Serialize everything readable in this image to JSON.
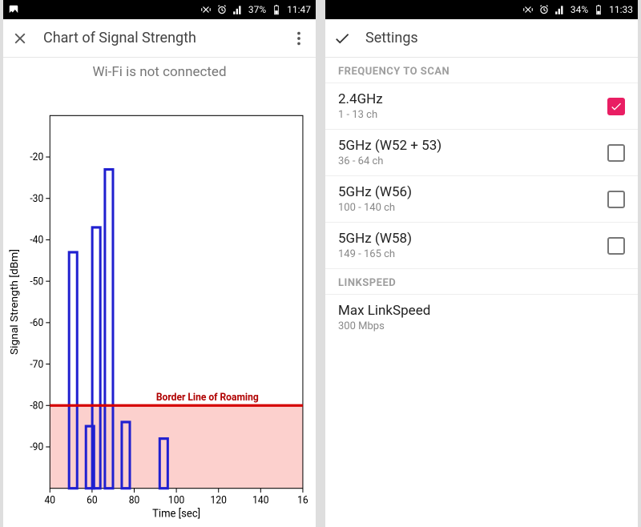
{
  "left": {
    "statusbar": {
      "battery": "37%",
      "time": "11:47"
    },
    "appbar_title": "Chart of Signal Strength",
    "subtitle": "Wi-Fi is not connected"
  },
  "right": {
    "statusbar": {
      "battery": "34%",
      "time": "11:33"
    },
    "appbar_title": "Settings",
    "section1": "FREQUENCY TO SCAN",
    "section2": "LINKSPEED",
    "options": [
      {
        "title": "2.4GHz",
        "sub": "1 - 13 ch",
        "checked": true
      },
      {
        "title": "5GHz (W52 + 53)",
        "sub": "36 - 64 ch",
        "checked": false
      },
      {
        "title": "5GHz (W56)",
        "sub": "100 - 140 ch",
        "checked": false
      },
      {
        "title": "5GHz (W58)",
        "sub": "149 - 165 ch",
        "checked": false
      }
    ],
    "linkspeed": {
      "title": "Max LinkSpeed",
      "sub": "300 Mbps"
    }
  },
  "chart_data": {
    "type": "bar",
    "title": "",
    "xlabel": "Time [sec]",
    "ylabel": "Signal Strength [dBm]",
    "x_ticks": [
      40,
      60,
      80,
      100,
      120,
      140,
      16
    ],
    "y_ticks": [
      -20,
      -30,
      -40,
      -50,
      -60,
      -70,
      -80,
      -90
    ],
    "ylim": [
      -100,
      -10
    ],
    "categories": [
      51,
      59,
      62,
      68,
      76,
      94
    ],
    "values": [
      -43,
      -85,
      -37,
      -23,
      -84,
      -88
    ],
    "roaming_threshold": -80,
    "roaming_label": "Border Line of Roaming"
  }
}
